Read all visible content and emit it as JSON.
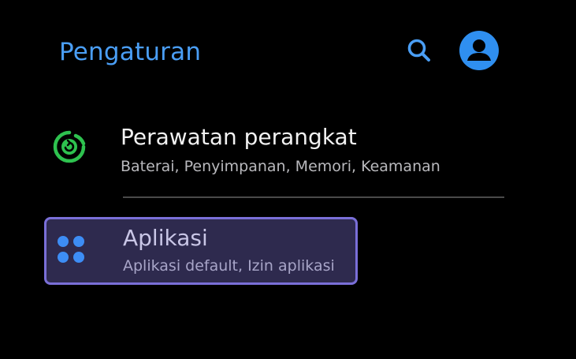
{
  "header": {
    "title": "Pengaturan",
    "search_icon": "search-icon",
    "profile_icon": "account-circle-icon",
    "accent_color": "#4a9ef5"
  },
  "items": [
    {
      "title": "Perawatan perangkat",
      "subtitle": "Baterai, Penyimpanan, Memori, Keamanan",
      "icon": "device-care-icon",
      "icon_color": "#2ec24f"
    },
    {
      "title": "Aplikasi",
      "subtitle": "Aplikasi default, Izin aplikasi",
      "icon": "apps-grid-icon",
      "icon_color": "#3d8df5",
      "highlighted": true
    }
  ]
}
